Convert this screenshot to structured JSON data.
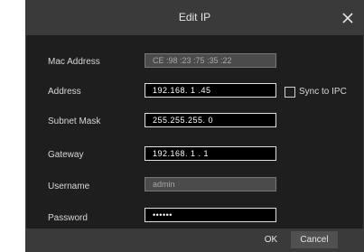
{
  "dialog": {
    "title": "Edit IP",
    "close_icon": "close-icon"
  },
  "form": {
    "mac_address": {
      "label": "Mac Address",
      "value": "CE :98 :23 :75 :35 :22"
    },
    "address": {
      "label": "Address",
      "value": "192.168. 1 .45"
    },
    "subnet_mask": {
      "label": "Subnet Mask",
      "value": "255.255.255. 0"
    },
    "gateway": {
      "label": "Gateway",
      "value": "192.168. 1 . 1"
    },
    "username": {
      "label": "Username",
      "value": "admin"
    },
    "password": {
      "label": "Password",
      "value": "••••••"
    },
    "sync_to_ipc": {
      "label": "Sync to IPC",
      "checked": false
    }
  },
  "footer": {
    "ok_label": "OK",
    "cancel_label": "Cancel"
  },
  "colors": {
    "dialog_bg": "#1e1e1e",
    "titlebar_bg": "#3a3a3a",
    "active_field_bg": "#000000",
    "disabled_field_bg": "#4b4b4b"
  }
}
